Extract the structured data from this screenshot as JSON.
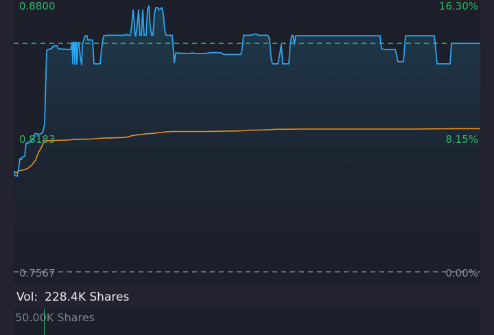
{
  "colors": {
    "price_line": "#2aa6f0",
    "avg_line": "#e8911f",
    "prev_close_line": "#2fb868",
    "baseline": "#7d8190",
    "up_text": "#2fb868",
    "neutral_text": "#8a8e9c"
  },
  "volume": {
    "label": "Vol:",
    "value": "228.4K Shares",
    "axis_max": "50.00K Shares"
  },
  "chart_data": {
    "type": "line",
    "y_left_ticks": [
      "0.8800",
      "0.8183",
      "0.7567"
    ],
    "y_right_ticks": [
      "16.30%",
      "8.15%",
      "0.00%"
    ],
    "ylim": [
      0.7567,
      0.88
    ],
    "xlim": [
      0,
      680
    ],
    "reference_line": {
      "value": 0.8625,
      "style": "dashed"
    },
    "baseline_line": {
      "value": 0.7567,
      "style": "dashed"
    },
    "series": [
      {
        "values": [
          [
            0,
            0.8035
          ],
          [
            2,
            0.8013
          ],
          [
            5,
            0.8009
          ],
          [
            7,
            0.8042
          ],
          [
            9,
            0.8092
          ],
          [
            11,
            0.8087
          ],
          [
            13,
            0.8101
          ],
          [
            16,
            0.8101
          ],
          [
            18,
            0.8163
          ],
          [
            21,
            0.8163
          ],
          [
            25,
            0.8172
          ],
          [
            29,
            0.8183
          ],
          [
            31,
            0.8207
          ],
          [
            38,
            0.8204
          ],
          [
            42,
            0.8211
          ],
          [
            45,
            0.8249
          ],
          [
            48,
            0.8592
          ],
          [
            52,
            0.8599
          ],
          [
            55,
            0.8599
          ],
          [
            57,
            0.8611
          ],
          [
            59,
            0.8611
          ],
          [
            60,
            0.8614
          ],
          [
            63,
            0.8614
          ],
          [
            65,
            0.8599
          ],
          [
            69,
            0.8599
          ],
          [
            80,
            0.8596
          ],
          [
            83,
            0.8596
          ],
          [
            85,
            0.863
          ],
          [
            86,
            0.853
          ],
          [
            87,
            0.863
          ],
          [
            88,
            0.863
          ],
          [
            89,
            0.8527
          ],
          [
            90,
            0.863
          ],
          [
            91,
            0.863
          ],
          [
            92,
            0.8527
          ],
          [
            94,
            0.863
          ],
          [
            95,
            0.863
          ],
          [
            97,
            0.856
          ],
          [
            99,
            0.8525
          ],
          [
            100,
            0.862
          ],
          [
            102,
            0.864
          ],
          [
            104,
            0.866
          ],
          [
            105,
            0.866
          ],
          [
            107,
            0.866
          ],
          [
            108,
            0.864
          ],
          [
            115,
            0.864
          ],
          [
            117,
            0.853
          ],
          [
            126,
            0.853
          ],
          [
            128,
            0.86
          ],
          [
            131,
            0.866
          ],
          [
            136,
            0.8662
          ],
          [
            162,
            0.8662
          ],
          [
            164,
            0.8668
          ],
          [
            166,
            0.8662
          ],
          [
            170,
            0.8662
          ],
          [
            172,
            0.871
          ],
          [
            174,
            0.878
          ],
          [
            176,
            0.871
          ],
          [
            177,
            0.866
          ],
          [
            178,
            0.866
          ],
          [
            180,
            0.871
          ],
          [
            182,
            0.878
          ],
          [
            184,
            0.8662
          ],
          [
            186,
            0.8662
          ],
          [
            188,
            0.878
          ],
          [
            190,
            0.8662
          ],
          [
            193,
            0.8662
          ],
          [
            195,
            0.878
          ],
          [
            197,
            0.8798
          ],
          [
            199,
            0.87
          ],
          [
            201,
            0.8662
          ],
          [
            203,
            0.8662
          ],
          [
            205,
            0.876
          ],
          [
            207,
            0.879
          ],
          [
            210,
            0.879
          ],
          [
            212,
            0.878
          ],
          [
            216,
            0.879
          ],
          [
            218,
            0.876
          ],
          [
            220,
            0.869
          ],
          [
            222,
            0.8662
          ],
          [
            229,
            0.8662
          ],
          [
            231,
            0.8662
          ],
          [
            233,
            0.858
          ],
          [
            234,
            0.8535
          ],
          [
            236,
            0.858
          ],
          [
            255,
            0.8578
          ],
          [
            261,
            0.858
          ],
          [
            265,
            0.8578
          ],
          [
            277,
            0.8578
          ],
          [
            285,
            0.858
          ],
          [
            288,
            0.8582
          ],
          [
            300,
            0.8582
          ],
          [
            303,
            0.858
          ],
          [
            306,
            0.8573
          ],
          [
            319,
            0.8573
          ],
          [
            331,
            0.8573
          ],
          [
            333,
            0.86
          ],
          [
            335,
            0.8662
          ],
          [
            337,
            0.8662
          ],
          [
            345,
            0.8662
          ],
          [
            352,
            0.8668
          ],
          [
            354,
            0.8668
          ],
          [
            356,
            0.8662
          ],
          [
            369,
            0.8662
          ],
          [
            371,
            0.866
          ],
          [
            373,
            0.864
          ],
          [
            375,
            0.856
          ],
          [
            377,
            0.853
          ],
          [
            385,
            0.853
          ],
          [
            388,
            0.858
          ],
          [
            390,
            0.862
          ],
          [
            392,
            0.853
          ],
          [
            401,
            0.853
          ],
          [
            403,
            0.862
          ],
          [
            405,
            0.866
          ],
          [
            407,
            0.8662
          ],
          [
            409,
            0.862
          ],
          [
            411,
            0.866
          ],
          [
            534,
            0.866
          ],
          [
            536,
            0.86
          ],
          [
            540,
            0.8596
          ],
          [
            556,
            0.8596
          ],
          [
            558,
            0.857
          ],
          [
            560,
            0.854
          ],
          [
            568,
            0.854
          ],
          [
            570,
            0.862
          ],
          [
            571,
            0.866
          ],
          [
            613,
            0.866
          ],
          [
            615,
            0.86
          ],
          [
            617,
            0.853
          ],
          [
            636,
            0.853
          ],
          [
            638,
            0.8625
          ],
          [
            680,
            0.8625
          ]
        ]
      },
      {
        "values": [
          [
            0,
            0.8033
          ],
          [
            4,
            0.8026
          ],
          [
            7,
            0.8035
          ],
          [
            12,
            0.8037
          ],
          [
            20,
            0.8045
          ],
          [
            26,
            0.806
          ],
          [
            32,
            0.8085
          ],
          [
            36,
            0.812
          ],
          [
            40,
            0.814
          ],
          [
            44,
            0.8172
          ],
          [
            47,
            0.8175
          ],
          [
            56,
            0.8175
          ],
          [
            65,
            0.8176
          ],
          [
            80,
            0.8177
          ],
          [
            88,
            0.818
          ],
          [
            100,
            0.8181
          ],
          [
            113,
            0.8182
          ],
          [
            130,
            0.8186
          ],
          [
            140,
            0.8187
          ],
          [
            160,
            0.8189
          ],
          [
            167,
            0.8192
          ],
          [
            173,
            0.8198
          ],
          [
            183,
            0.8202
          ],
          [
            193,
            0.8206
          ],
          [
            203,
            0.8208
          ],
          [
            213,
            0.8212
          ],
          [
            223,
            0.8215
          ],
          [
            233,
            0.8217
          ],
          [
            243,
            0.8217
          ],
          [
            263,
            0.8217
          ],
          [
            283,
            0.8217
          ],
          [
            303,
            0.8218
          ],
          [
            323,
            0.8219
          ],
          [
            333,
            0.822
          ],
          [
            343,
            0.8223
          ],
          [
            353,
            0.8223
          ],
          [
            373,
            0.8225
          ],
          [
            383,
            0.8227
          ],
          [
            393,
            0.8227
          ],
          [
            423,
            0.8228
          ],
          [
            453,
            0.8228
          ],
          [
            483,
            0.8228
          ],
          [
            513,
            0.8228
          ],
          [
            543,
            0.8228
          ],
          [
            583,
            0.8228
          ],
          [
            613,
            0.8229
          ],
          [
            643,
            0.823
          ],
          [
            680,
            0.823
          ]
        ]
      }
    ],
    "grid": false
  }
}
